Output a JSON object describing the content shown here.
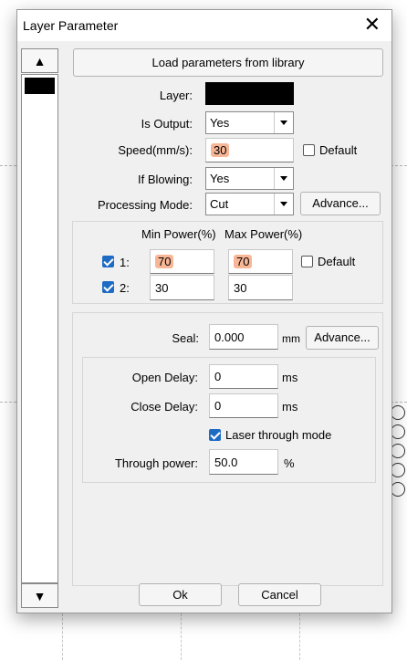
{
  "window": {
    "title": "Layer Parameter",
    "close_label": "✕"
  },
  "sidebar": {
    "up_label": "▲",
    "down_label": "▼"
  },
  "load_button_label": "Load parameters from library",
  "layer": {
    "label": "Layer:",
    "color": "#000000",
    "is_output_label": "Is Output:",
    "is_output_value": "Yes",
    "speed_label": "Speed(mm/s):",
    "speed_value": "30",
    "default_label": "Default",
    "if_blowing_label": "If Blowing:",
    "if_blowing_value": "Yes",
    "mode_label": "Processing Mode:",
    "mode_value": "Cut",
    "advance_label": "Advance..."
  },
  "power": {
    "min_header": "Min Power(%)",
    "max_header": "Max Power(%)",
    "default_label": "Default",
    "rows": [
      {
        "label": "1:",
        "min": "70",
        "max": "70",
        "checked": true
      },
      {
        "label": "2:",
        "min": "30",
        "max": "30",
        "checked": true
      }
    ]
  },
  "seal": {
    "label": "Seal:",
    "value": "0.000",
    "unit": "mm",
    "advance_label": "Advance..."
  },
  "delays": {
    "open_label": "Open Delay:",
    "open_value": "0",
    "open_unit": "ms",
    "close_label": "Close Delay:",
    "close_value": "0",
    "close_unit": "ms",
    "through_mode_label": "Laser through mode",
    "through_power_label": "Through power:",
    "through_power_value": "50.0",
    "through_power_unit": "%"
  },
  "footer": {
    "ok_label": "Ok",
    "cancel_label": "Cancel"
  },
  "colors": {
    "accent": "#1e6bc4",
    "highlight": "#f7b696"
  }
}
